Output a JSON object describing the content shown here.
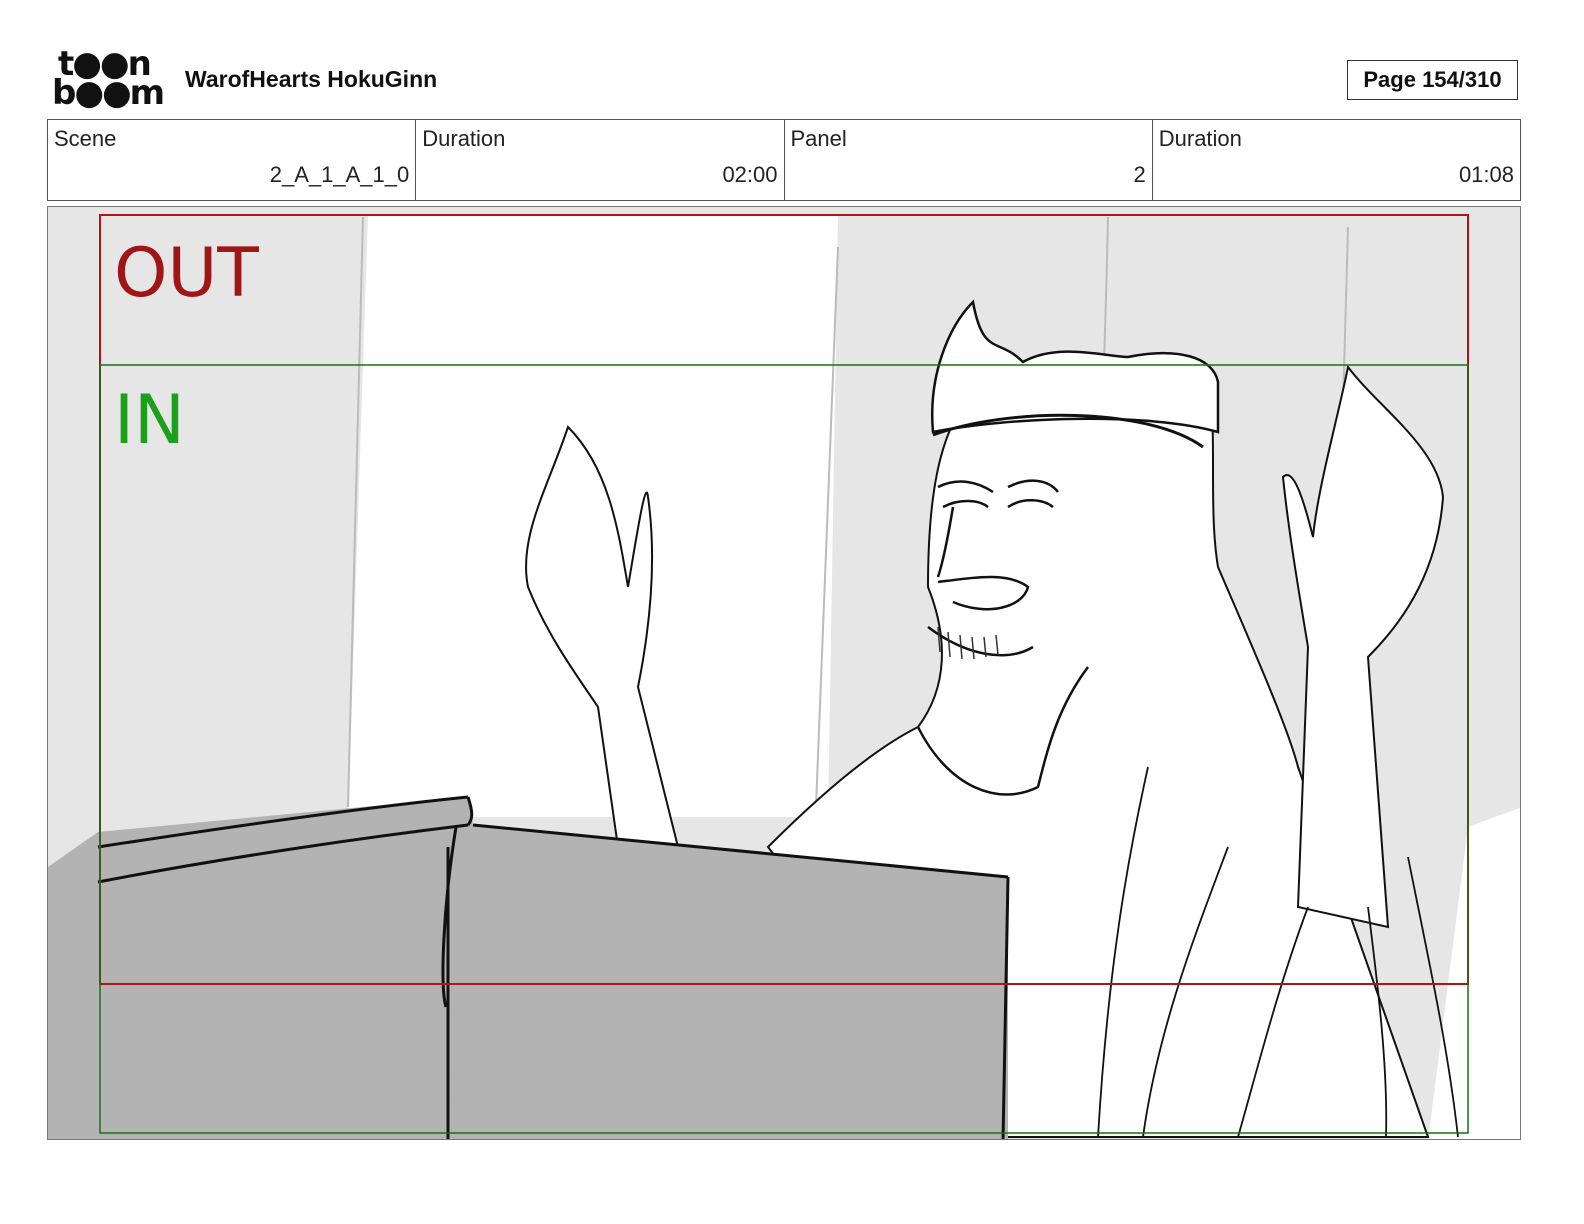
{
  "header": {
    "logo_line1": "t●●n",
    "logo_line2": "b●●m",
    "project_title": "WarofHearts HokuGinn",
    "page_label": "Page 154/310"
  },
  "info": {
    "scene_label": "Scene",
    "scene_value": "2_A_1_A_1_0",
    "scene_duration_label": "Duration",
    "scene_duration_value": "02:00",
    "panel_label": "Panel",
    "panel_value": "2",
    "panel_duration_label": "Duration",
    "panel_duration_value": "01:08"
  },
  "frame": {
    "out_label": "OUT",
    "in_label": "IN",
    "out_color": "#a01515",
    "in_color": "#1aa01a"
  }
}
